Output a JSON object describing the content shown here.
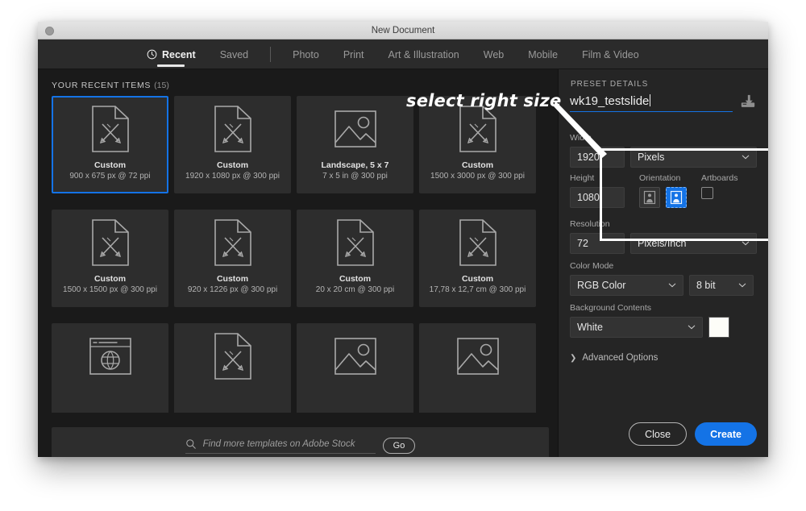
{
  "window": {
    "title": "New Document",
    "close_icon": "close-dot-icon"
  },
  "tabs": [
    {
      "label": "Recent",
      "icon": "clock-icon",
      "active": true
    },
    {
      "label": "Saved",
      "active": false
    },
    {
      "label": "Photo",
      "active": false
    },
    {
      "label": "Print",
      "active": false
    },
    {
      "label": "Art & Illustration",
      "active": false
    },
    {
      "label": "Web",
      "active": false
    },
    {
      "label": "Mobile",
      "active": false
    },
    {
      "label": "Film & Video",
      "active": false
    }
  ],
  "recent": {
    "heading": "YOUR RECENT ITEMS",
    "count": "(15)",
    "items": [
      {
        "name": "Custom",
        "dimensions": "900 x 675 px @ 72 ppi",
        "icon": "document-pencil-ruler-icon",
        "selected": true
      },
      {
        "name": "Custom",
        "dimensions": "1920 x 1080 px @ 300 ppi",
        "icon": "document-pencil-ruler-icon",
        "selected": false
      },
      {
        "name": "Landscape, 5 x 7",
        "dimensions": "7 x 5 in @ 300 ppi",
        "icon": "photo-icon",
        "selected": false
      },
      {
        "name": "Custom",
        "dimensions": "1500 x 3000 px @ 300 ppi",
        "icon": "document-pencil-ruler-icon",
        "selected": false
      },
      {
        "name": "Custom",
        "dimensions": "1500 x 1500 px @ 300 ppi",
        "icon": "document-pencil-ruler-icon",
        "selected": false
      },
      {
        "name": "Custom",
        "dimensions": "920 x 1226 px @ 300 ppi",
        "icon": "document-pencil-ruler-icon",
        "selected": false
      },
      {
        "name": "Custom",
        "dimensions": "20 x 20 cm @ 300 ppi",
        "icon": "document-pencil-ruler-icon",
        "selected": false
      },
      {
        "name": "Custom",
        "dimensions": "17,78 x 12,7 cm @ 300 ppi",
        "icon": "document-pencil-ruler-icon",
        "selected": false
      },
      {
        "name": "",
        "dimensions": "",
        "icon": "browser-globe-icon",
        "selected": false
      },
      {
        "name": "",
        "dimensions": "",
        "icon": "document-pencil-ruler-icon",
        "selected": false
      },
      {
        "name": "",
        "dimensions": "",
        "icon": "photo-icon",
        "selected": false
      },
      {
        "name": "",
        "dimensions": "",
        "icon": "photo-icon",
        "selected": false
      }
    ]
  },
  "stock": {
    "placeholder": "Find more templates on Adobe Stock",
    "value": "",
    "go_label": "Go",
    "search_icon": "search-icon"
  },
  "preset": {
    "section_title": "PRESET DETAILS",
    "name_value": "wk19_testslide",
    "save_preset_icon": "save-preset-icon",
    "width": {
      "label": "Width",
      "value": "1920",
      "unit": "Pixels"
    },
    "height": {
      "label": "Height",
      "value": "1080"
    },
    "orientation": {
      "label": "Orientation",
      "portrait_icon": "orientation-portrait-icon",
      "landscape_icon": "orientation-landscape-icon",
      "selected": "landscape"
    },
    "artboards": {
      "label": "Artboards",
      "checked": false
    },
    "resolution": {
      "label": "Resolution",
      "value": "72",
      "unit": "Pixels/Inch"
    },
    "color_mode": {
      "label": "Color Mode",
      "value": "RGB Color",
      "depth": "8 bit"
    },
    "background": {
      "label": "Background Contents",
      "value": "White",
      "swatch_color": "#FFFFFF"
    },
    "advanced": {
      "label": "Advanced Options",
      "expanded": false
    }
  },
  "actions": {
    "close_label": "Close",
    "create_label": "Create"
  },
  "annotation": {
    "text": "select right size",
    "arrow": "annotation-arrow-icon",
    "highlight": "annotation-highlight-box"
  },
  "colors": {
    "accent_blue": "#1473E6",
    "panel_bg": "#252525",
    "grid_bg": "#1A1A1A",
    "card_bg": "#2D2D2D",
    "annotation_white": "#FFFFFF"
  }
}
